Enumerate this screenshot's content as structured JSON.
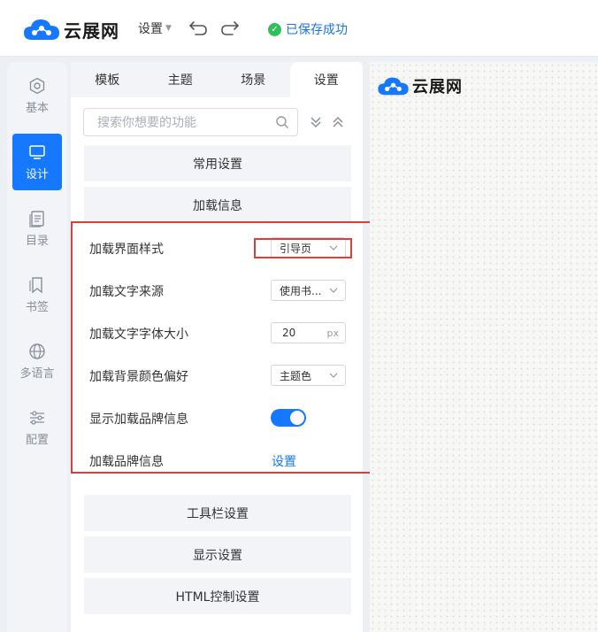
{
  "header": {
    "brand": "云展网",
    "settings_menu": "设置",
    "save_status": "已保存成功",
    "accent": "#1677ff",
    "success_color": "#2ec15b"
  },
  "rail": {
    "items": [
      {
        "label": "基本",
        "icon": "hexagon-settings-icon",
        "active": false
      },
      {
        "label": "设计",
        "icon": "monitor-icon",
        "active": true
      },
      {
        "label": "目录",
        "icon": "document-list-icon",
        "active": false
      },
      {
        "label": "书签",
        "icon": "bookmark-icon",
        "active": false
      },
      {
        "label": "多语言",
        "icon": "globe-icon",
        "active": false
      },
      {
        "label": "配置",
        "icon": "sliders-icon",
        "active": false
      }
    ]
  },
  "tabs": [
    "模板",
    "主题",
    "场景",
    "设置"
  ],
  "active_tab": "设置",
  "search": {
    "placeholder": "搜索你想要的功能"
  },
  "sections": {
    "common": "常用设置",
    "loading": "加载信息",
    "toolbar": "工具栏设置",
    "display": "显示设置",
    "html": "HTML控制设置"
  },
  "loading_settings": {
    "style_label": "加载界面样式",
    "style_value": "引导页",
    "text_source_label": "加载文字来源",
    "text_source_value": "使用书...",
    "font_size_label": "加载文字字体大小",
    "font_size_value": "20",
    "font_size_unit": "px",
    "bg_color_label": "加载背景颜色偏好",
    "bg_color_value": "主题色",
    "show_brand_label": "显示加载品牌信息",
    "show_brand_on": true,
    "brand_info_label": "加载品牌信息",
    "brand_info_link": "设置"
  },
  "preview": {
    "brand": "云展网"
  },
  "highlight_color": "#e03c3c"
}
